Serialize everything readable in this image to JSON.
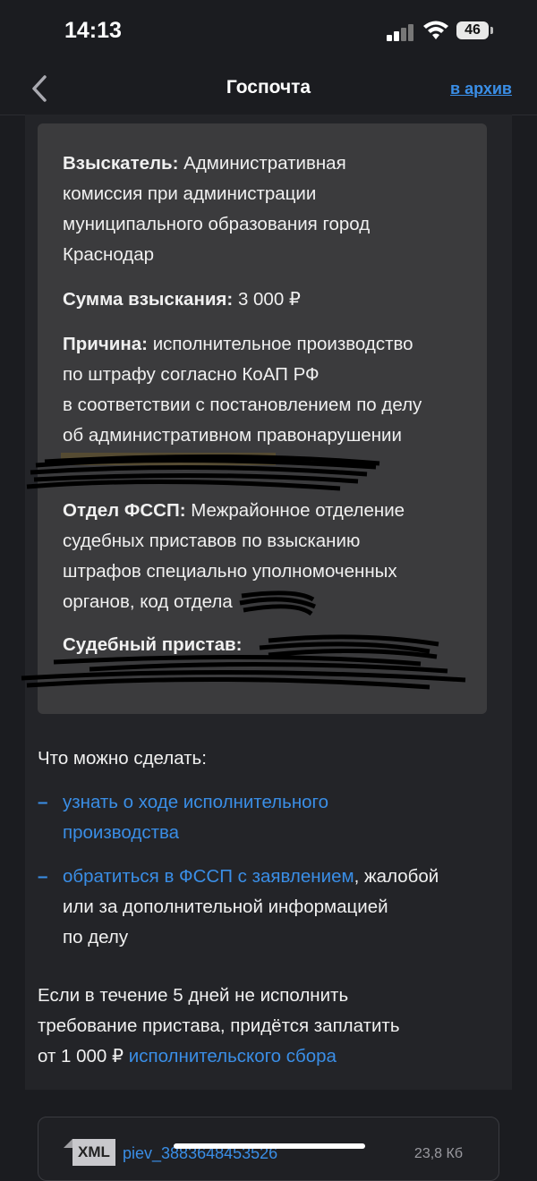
{
  "status_bar": {
    "time": "14:13",
    "battery": "46"
  },
  "header": {
    "title": "Госпочта",
    "archive_link": "в архив"
  },
  "info": {
    "claimant_label": "Взыскатель:",
    "claimant_line1": "Административная",
    "claimant_line2": "комиссия при администрации",
    "claimant_line3": "муниципального образования город",
    "claimant_line4": "Краснодар",
    "amount_label": "Сумма взыскания:",
    "amount_value": "3 000 ₽",
    "reason_label": "Причина:",
    "reason_line1": "исполнительное производство",
    "reason_line2": "по штрафу согласно КоАП РФ",
    "reason_line3": "в соответствии с постановлением по делу",
    "reason_line4": "об административном правонарушении",
    "department_label": "Отдел ФССП:",
    "department_line1": "Межрайонное отделение",
    "department_line2": "судебных приставов по взысканию",
    "department_line3": "штрафов специально уполномоченных",
    "department_line4": "органов, код отдела",
    "bailiff_label": "Судебный пристав:"
  },
  "actions": {
    "title": "Что можно сделать:",
    "item1_link_line1": "узнать о ходе исполнительного",
    "item1_link_line2": "производства",
    "item2_link": "обратиться в ФССП с заявлением",
    "item2_rest_line1": ", жалобой",
    "item2_rest_line2": "или за дополнительной информацией",
    "item2_rest_line3": "по делу",
    "dash": "–"
  },
  "warning": {
    "line1": "Если в течение 5 дней не исполнить",
    "line2": "требование пристава, придётся заплатить",
    "line3_prefix": "от 1 000 ₽ ",
    "line3_link": "исполнительского сбора"
  },
  "attachment": {
    "type": "XML",
    "file_name": "piev_3883648453526",
    "size": "23,8 Кб"
  }
}
